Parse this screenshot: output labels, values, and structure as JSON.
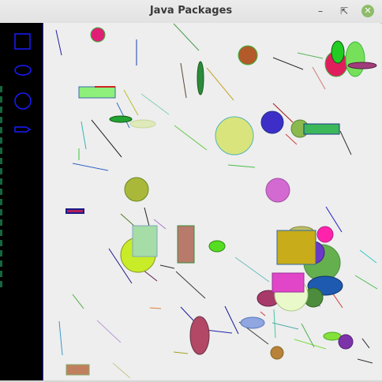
{
  "window": {
    "title": "Java Packages",
    "controls": {
      "minimize_icon": "minimize-icon",
      "maximize_icon": "restore-icon",
      "close_icon": "close-icon"
    }
  },
  "palette": {
    "tools": [
      "rectangle-tool-icon",
      "ellipse-tool-icon",
      "circle-tool-icon",
      "line-tool-icon"
    ],
    "tool_color": "#1a1aff"
  },
  "canvas": {
    "background": "#eeeeee"
  }
}
